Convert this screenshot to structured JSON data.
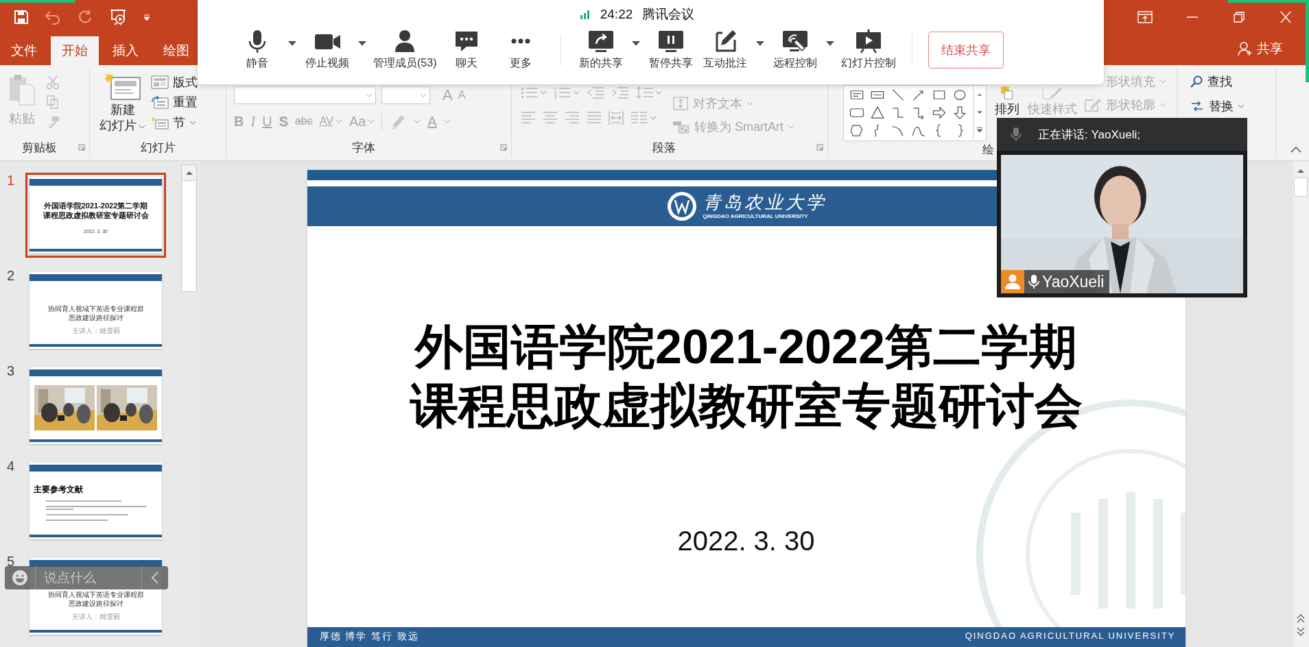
{
  "tabs": [
    {
      "label": "文件",
      "selected": false
    },
    {
      "label": "开始",
      "selected": true
    },
    {
      "label": "插入",
      "selected": false
    },
    {
      "label": "绘图",
      "selected": false
    }
  ],
  "share_button": "共享",
  "ribbon": {
    "clipboard": {
      "label": "剪贴板",
      "paste": {
        "label": "粘贴",
        "disabled": true
      }
    },
    "slides": {
      "label": "幻灯片",
      "new_slide": {
        "lines": [
          "新建",
          "幻灯片"
        ],
        "disabled": false
      },
      "layout": "版式",
      "reset": "重置",
      "section": "节"
    },
    "font": {
      "label": "字体",
      "disabled": true,
      "grow": "A",
      "shrink": "A",
      "styles": [
        {
          "label": "B",
          "caret": false
        },
        {
          "label": "I",
          "caret": false
        },
        {
          "label": "U",
          "caret": false
        },
        {
          "label": "S",
          "caret": false
        },
        {
          "label": "abc",
          "caret": false
        },
        {
          "label": "AV",
          "caret": true
        },
        {
          "label": "Aa",
          "caret": true
        }
      ],
      "color_button": "A"
    },
    "paragraph": {
      "label": "段落",
      "disabled": true,
      "align_text": "对齐文本",
      "smartart": "转换为 SmartArt"
    },
    "drawing": {
      "label": "绘",
      "arrange": {
        "label": "排列",
        "disabled": false
      },
      "quick_styles": {
        "label": "快速样式",
        "disabled": true
      },
      "fill": {
        "label": "形状填充",
        "disabled": true
      },
      "outline": {
        "label": "形状轮廓",
        "disabled": true
      }
    },
    "editing": {
      "find": "查找",
      "replace": "替换"
    }
  },
  "meeting": {
    "time": "24:22",
    "app": "腾讯会议",
    "buttons": [
      {
        "kind": "mic",
        "label": "静音",
        "caret": true
      },
      {
        "kind": "camera",
        "label": "停止视频",
        "caret": true
      },
      {
        "kind": "person",
        "label": "管理成员(53)",
        "caret": false
      },
      {
        "kind": "chat",
        "label": "聊天",
        "caret": false
      },
      {
        "kind": "more",
        "label": "更多",
        "caret": false
      },
      {
        "kind": "share",
        "label": "新的共享",
        "caret": true
      },
      {
        "kind": "pause",
        "label": "暂停共享",
        "caret": false
      },
      {
        "kind": "annotate",
        "label": "互动批注",
        "caret": true
      },
      {
        "kind": "remote",
        "label": "远程控制",
        "caret": true
      },
      {
        "kind": "slideshow",
        "label": "幻灯片控制",
        "caret": false
      }
    ],
    "end_button": "结束共享"
  },
  "slides": [
    {
      "number": "1",
      "selected": true,
      "kind": "title",
      "lines": [
        "外国语学院2021-2022第二学期",
        "课程思政虚拟教研室专题研讨会"
      ],
      "date": "2022. 3. 30"
    },
    {
      "number": "2",
      "selected": false,
      "kind": "topic",
      "lines": [
        "协同育人视域下英语专业课程群",
        "思政建设路径探讨"
      ],
      "presenter": "主讲人：姚雪丽"
    },
    {
      "number": "3",
      "selected": false,
      "kind": "photos"
    },
    {
      "number": "4",
      "selected": false,
      "kind": "references",
      "heading": "主要参考文献"
    },
    {
      "number": "5",
      "selected": false,
      "kind": "topic",
      "lines": [
        "协同育人视域下英语专业课程群",
        "思政建设路径探讨"
      ],
      "presenter": "主讲人：姚雪丽"
    }
  ],
  "slide": {
    "logo_name": "青岛农业大学",
    "logo_subtitle": "QINGDAO AGRICULTURAL UNIVERSITY",
    "title_lines": [
      "外国语学院2021-2022第二学期",
      "课程思政虚拟教研室专题研讨会"
    ],
    "date": "2022. 3. 30",
    "motto": "厚德 博学 笃行 致远",
    "footer": "QINGDAO AGRICULTURAL UNIVERSITY"
  },
  "video": {
    "speaking": "正在讲话: YaoXueli;",
    "name": "YaoXueli"
  },
  "chat": {
    "placeholder": "说点什么"
  }
}
